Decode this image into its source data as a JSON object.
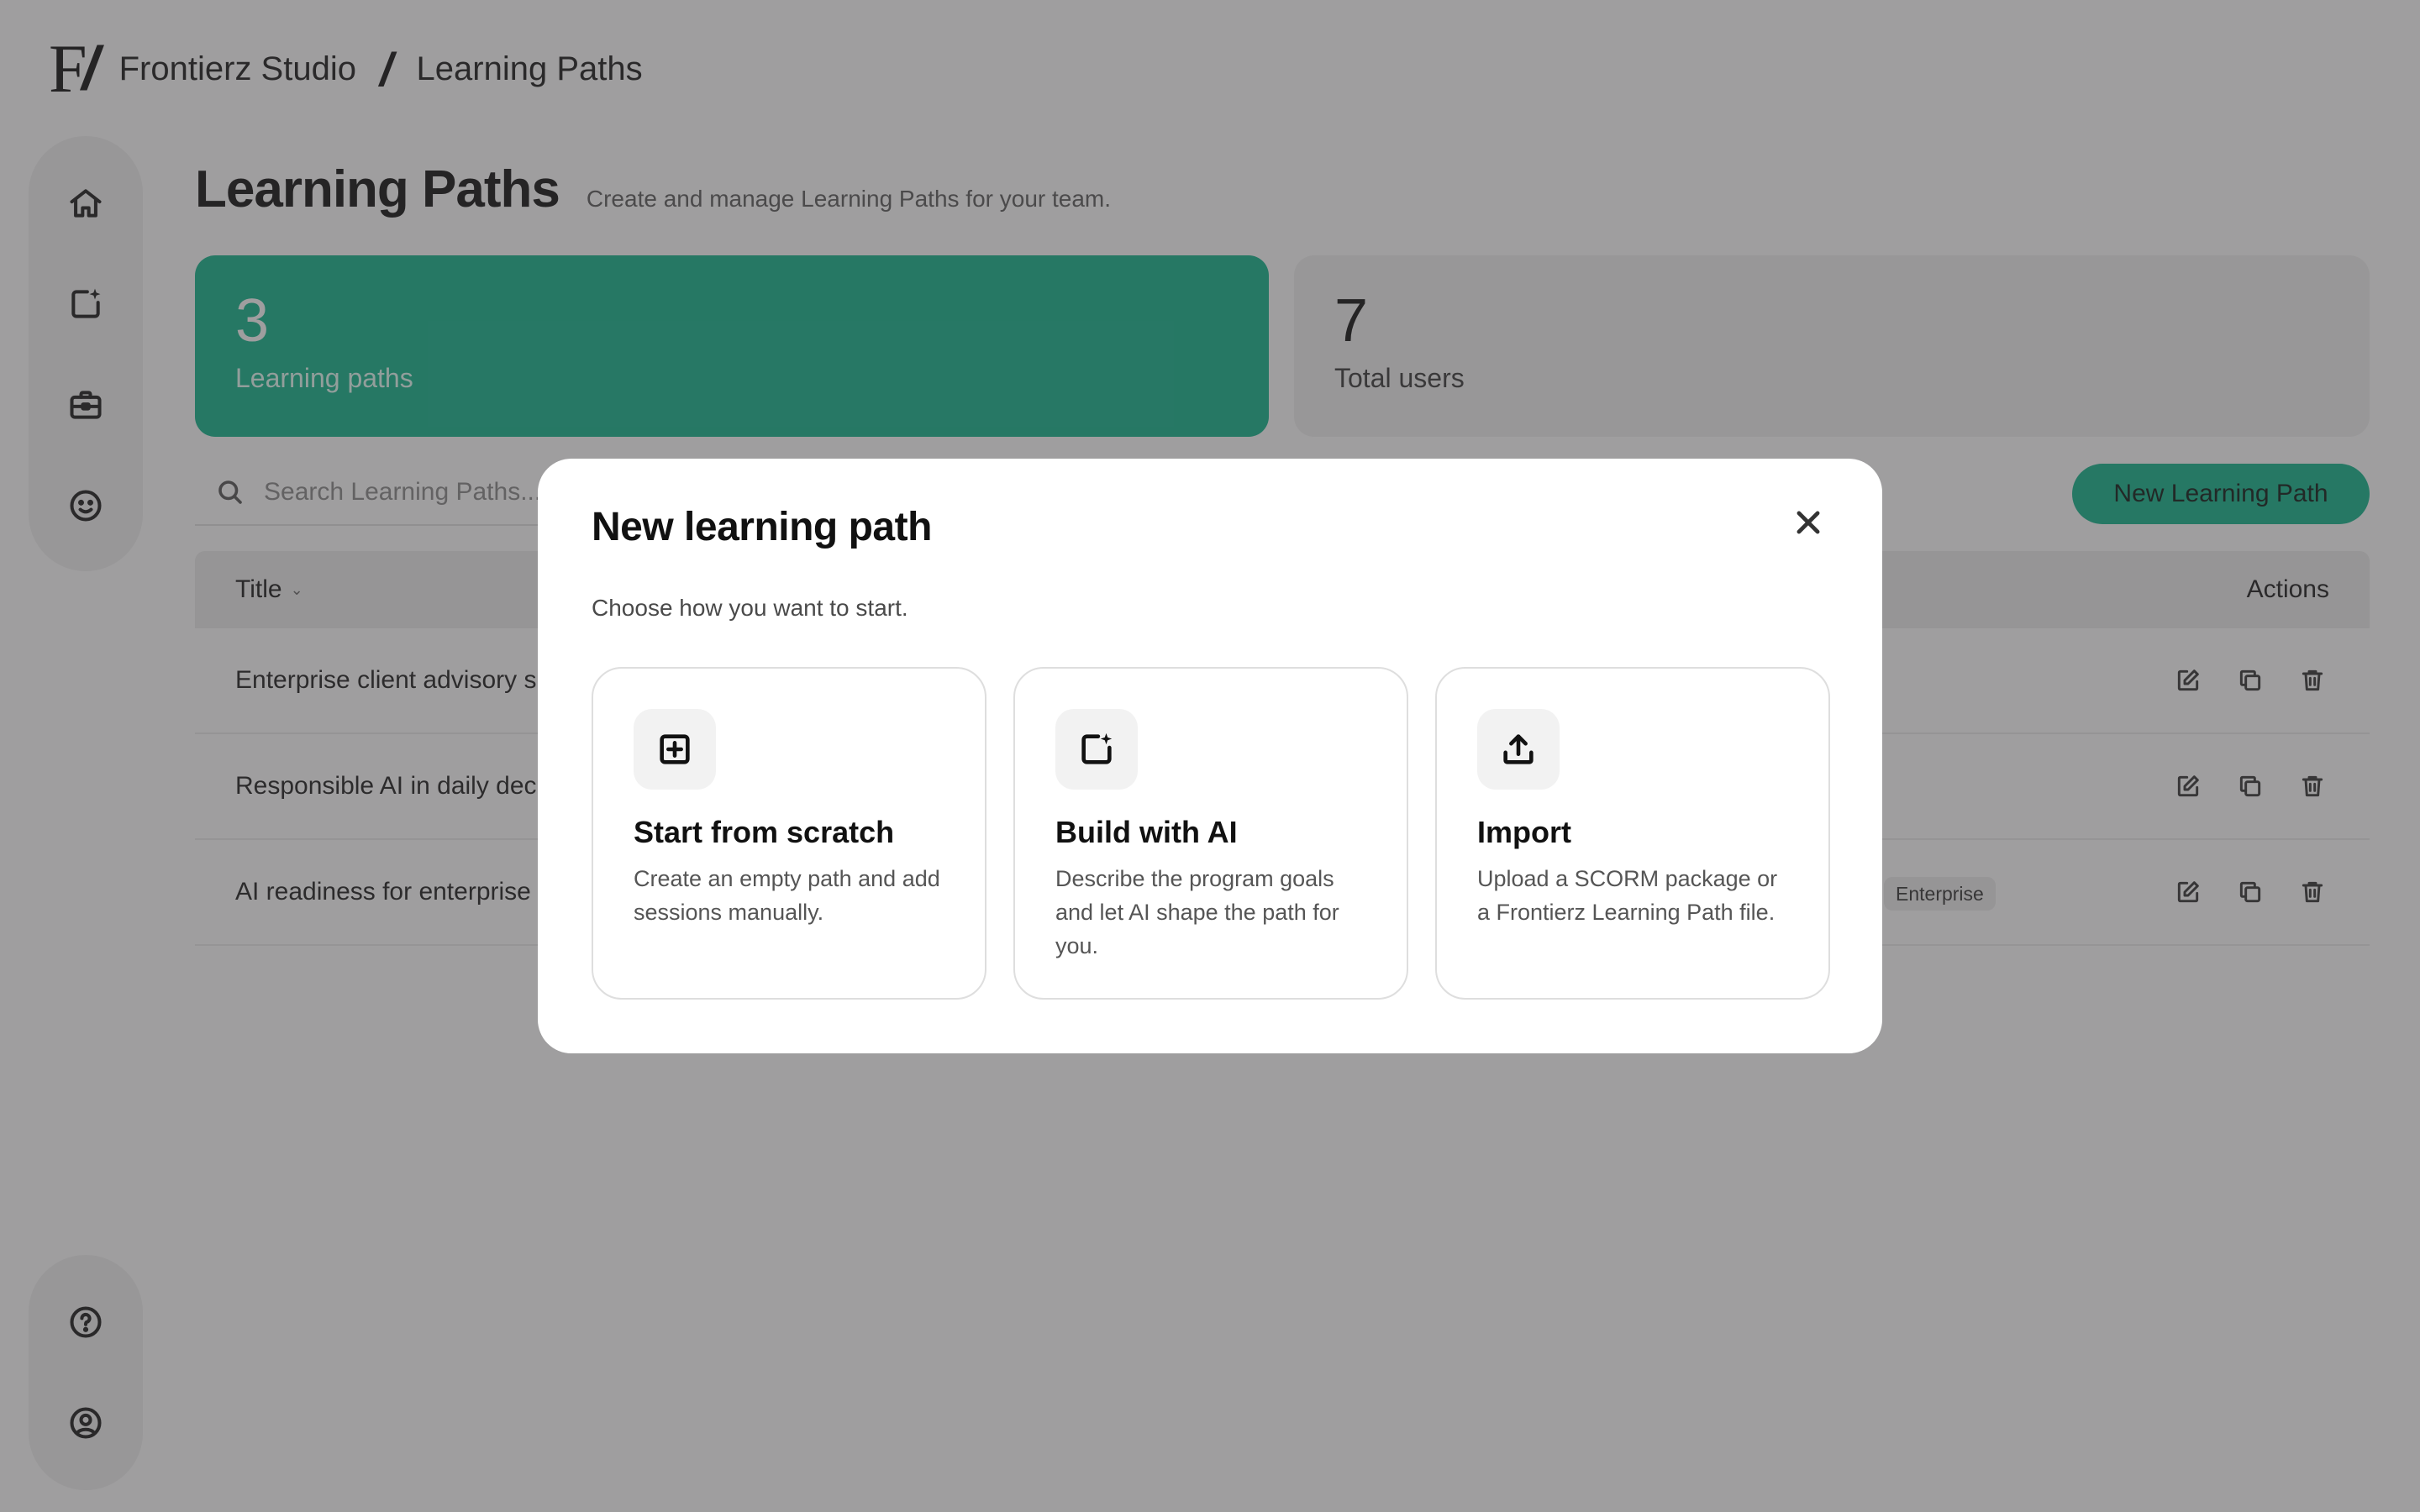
{
  "header": {
    "logo": "F",
    "logo_slash": "/",
    "workspace": "Frontierz Studio",
    "separator": "/",
    "current_page": "Learning Paths"
  },
  "sidebar": {
    "items": [
      {
        "icon": "home-icon"
      },
      {
        "icon": "sparkle-document-icon"
      },
      {
        "icon": "briefcase-icon"
      },
      {
        "icon": "smiley-icon"
      }
    ],
    "bottom_items": [
      {
        "icon": "help-icon"
      },
      {
        "icon": "user-icon"
      }
    ]
  },
  "page": {
    "title": "Learning Paths",
    "subtitle": "Create and manage Learning Paths for your team."
  },
  "stats": [
    {
      "value": "3",
      "label": "Learning paths"
    },
    {
      "value": "7",
      "label": "Total users"
    }
  ],
  "search": {
    "placeholder": "Search Learning Paths..."
  },
  "new_button": {
    "label": "New Learning Path"
  },
  "table": {
    "columns": {
      "title": "Title",
      "actions": "Actions"
    },
    "rows": [
      {
        "title": "Enterprise client advisory simulation",
        "tag": ""
      },
      {
        "title": "Responsible AI in daily decisions",
        "tag": ""
      },
      {
        "title": "AI readiness for enterprise teams",
        "tag": "Enterprise"
      }
    ]
  },
  "modal": {
    "title": "New learning path",
    "subtitle": "Choose how you want to start.",
    "options": [
      {
        "icon": "plus-square-icon",
        "title": "Start from scratch",
        "description": "Create an empty path and add sessions manually."
      },
      {
        "icon": "sparkle-document-icon",
        "title": "Build with AI",
        "description": "Describe the program goals and let AI shape the path for you."
      },
      {
        "icon": "upload-icon",
        "title": "Import",
        "description": "Upload a SCORM package or a Frontierz Learning Path file."
      }
    ]
  },
  "colors": {
    "accent": "#12b48c",
    "overlay": "rgba(60,58,60,0.49)"
  }
}
